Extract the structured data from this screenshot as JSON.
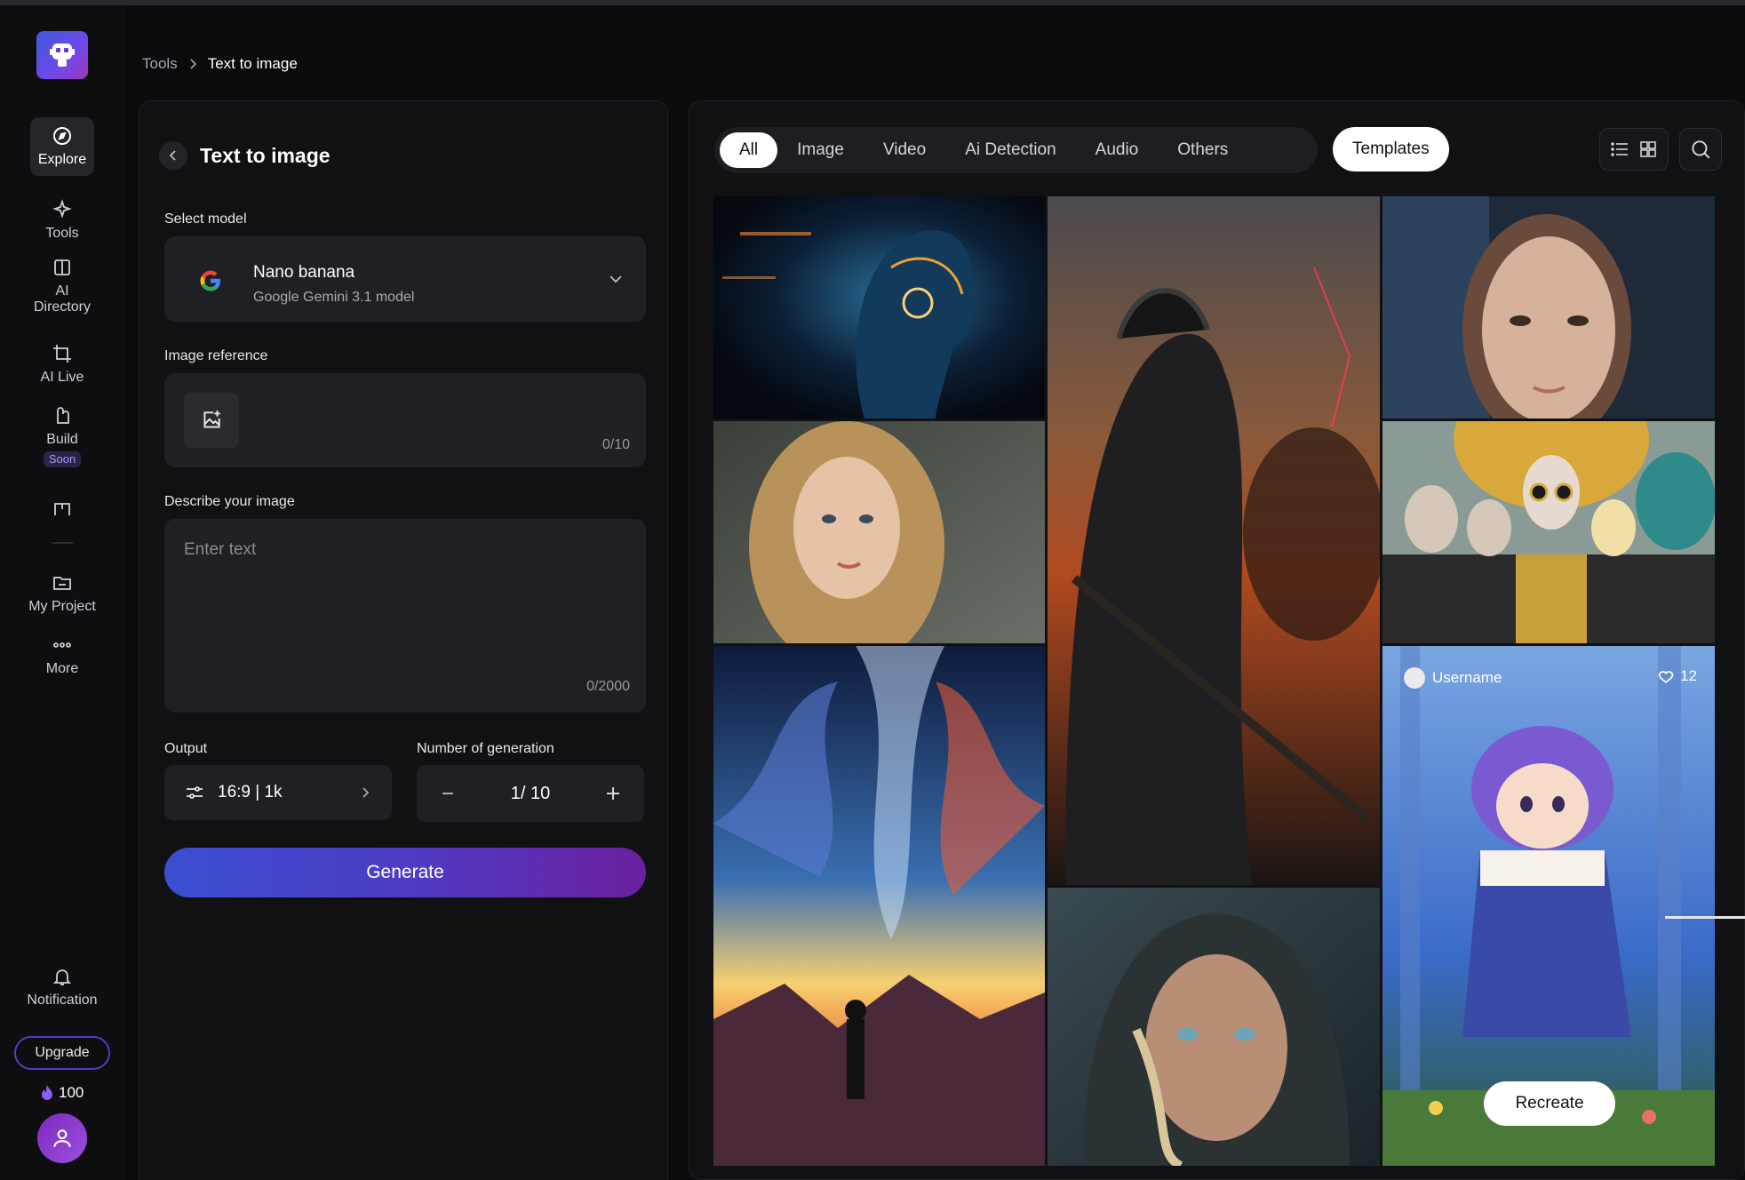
{
  "sidebar": {
    "items": [
      {
        "label": "Explore",
        "icon": "compass-icon"
      },
      {
        "label": "Tools",
        "icon": "sparkle-icon"
      },
      {
        "label": "AI Directory",
        "icon": "directory-icon"
      },
      {
        "label": "AI Live",
        "icon": "crop-frame-icon"
      },
      {
        "label": "Build",
        "icon": "build-icon",
        "badge": "Soon"
      },
      {
        "label": "",
        "icon": "split-frame-icon"
      },
      {
        "label": "My Project",
        "icon": "folder-icon"
      },
      {
        "label": "More",
        "icon": "more-dots-icon"
      },
      {
        "label": "Notification",
        "icon": "bell-icon"
      }
    ],
    "upgrade_label": "Upgrade",
    "credits": "100"
  },
  "breadcrumb": {
    "root": "Tools",
    "current": "Text to image"
  },
  "panel": {
    "title": "Text to image",
    "model": {
      "label": "Select model",
      "name": "Nano banana",
      "subtitle": "Google Gemini 3.1 model"
    },
    "image_reference": {
      "label": "Image reference",
      "count": "0/10"
    },
    "describe": {
      "label": "Describe your image",
      "placeholder": "Enter text",
      "count": "0/2000"
    },
    "output": {
      "label": "Output",
      "value": "16:9 | 1k"
    },
    "generation": {
      "label": "Number of generation",
      "value": "1/ 10"
    },
    "generate_label": "Generate"
  },
  "gallery": {
    "tabs": [
      "All",
      "Image",
      "Video",
      "Ai Detection",
      "Audio",
      "Others"
    ],
    "active_tab": "All",
    "templates_label": "Templates",
    "hover_card": {
      "username": "Username",
      "likes": "12",
      "recreate_label": "Recreate"
    }
  },
  "colors": {
    "accent_start": "#3b4fd1",
    "accent_end": "#6a1f9e",
    "panel_bg": "#111114",
    "field_bg": "#1f1f24"
  }
}
